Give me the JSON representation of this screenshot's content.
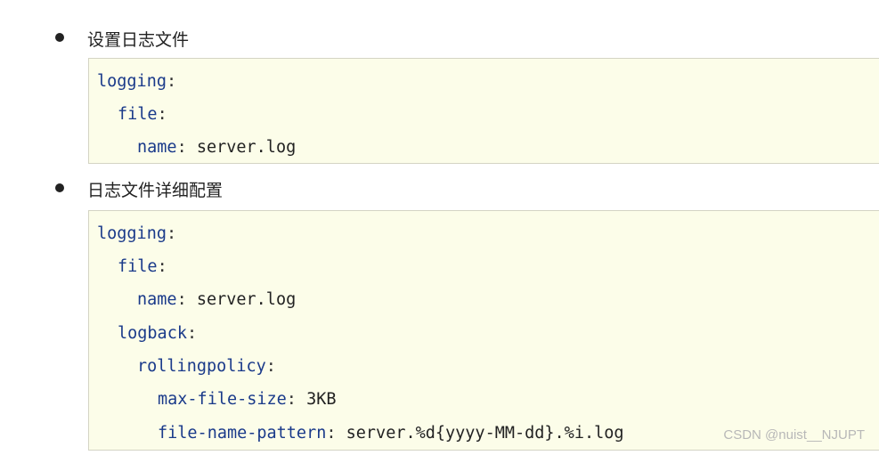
{
  "bullets": [
    {
      "label": "设置日志文件",
      "code": [
        {
          "key": "logging",
          "sep": ":",
          "value": ""
        },
        {
          "key": "file",
          "sep": ":",
          "value": ""
        },
        {
          "key": "name",
          "sep": ": ",
          "value": "server.log"
        }
      ]
    },
    {
      "label": "日志文件详细配置",
      "code": [
        {
          "key": "logging",
          "sep": ":",
          "value": ""
        },
        {
          "key": "file",
          "sep": ":",
          "value": ""
        },
        {
          "key": "name",
          "sep": ": ",
          "value": "server.log"
        },
        {
          "key": "logback",
          "sep": ":",
          "value": ""
        },
        {
          "key": "rollingpolicy",
          "sep": ":",
          "value": ""
        },
        {
          "key": "max-file-size",
          "sep": ": ",
          "value": "3KB"
        },
        {
          "key": "file-name-pattern",
          "sep": ": ",
          "value": "server.%d{yyyy-MM-dd}.%i.log"
        }
      ]
    }
  ],
  "watermark": "CSDN @nuist__NJUPT",
  "colors": {
    "code_background": "#fcfde9",
    "code_key": "#1a3a8a",
    "text": "#222222"
  }
}
